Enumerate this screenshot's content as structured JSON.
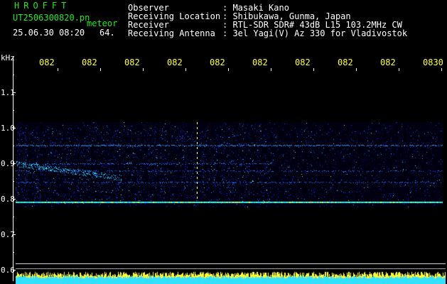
{
  "header": {
    "app_name": "HROFFT",
    "filename": "UT2506300820.pn",
    "mode": "meteor",
    "datetime": "25.06.30 08:20",
    "count": "64."
  },
  "info": [
    {
      "label": "Observer",
      "value": ": Masaki Kano"
    },
    {
      "label": "Receiving Location",
      "value": ": Shibukawa, Gunma, Japan"
    },
    {
      "label": "Receiver",
      "value": ": RTL-SDR SDR# 43dB L15 103.2MHz CW"
    },
    {
      "label": "Receiving Antenna",
      "value": ": 3el Yagi(V) Az 330 for Vladivostok"
    }
  ],
  "axis": {
    "unit": "kHz",
    "freq_labels": [
      "1.1",
      "1.0",
      "0.9",
      "0.8",
      "0.7",
      "0.6"
    ],
    "time_labels": [
      "082",
      "082",
      "082",
      "082",
      "082",
      "082",
      "082",
      "082",
      "082",
      "0830"
    ]
  },
  "colors": {
    "background": "#000000",
    "text_green": "#22e822",
    "text_yellow": "#ffff33",
    "noise_blue": "#1a3cff",
    "bar_cyan": "#33e0ff",
    "bar_yellow": "#ffff33"
  }
}
